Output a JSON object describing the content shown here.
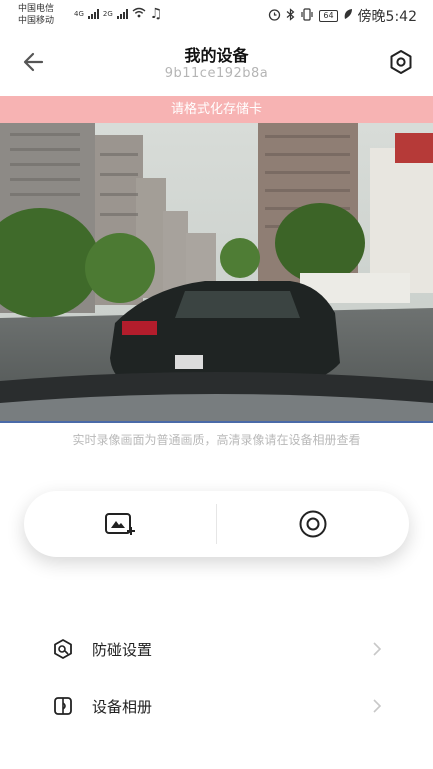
{
  "status_bar": {
    "carrier_1": "中国电信",
    "carrier_2": "中国移动",
    "net_1": "4G",
    "net_2": "2G",
    "battery": "64",
    "time": "傍晚5:42"
  },
  "header": {
    "title": "我的设备",
    "device_id": "9b11ce192b8a"
  },
  "banner": {
    "text": "请格式化存储卡"
  },
  "video": {
    "hint": "实时录像画面为普通画质，高清录像请在设备相册查看"
  },
  "menu": {
    "items": [
      {
        "label": "防碰设置",
        "icon": "collision-icon"
      },
      {
        "label": "设备相册",
        "icon": "album-icon"
      }
    ]
  },
  "colors": {
    "banner_bg": "#f7b3b3",
    "hint_text": "#b9b9b9",
    "video_border": "#4a6aa8"
  }
}
